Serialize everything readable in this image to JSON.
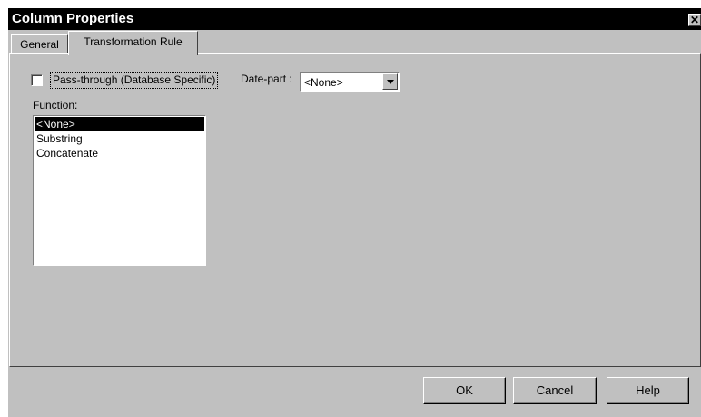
{
  "window": {
    "title": "Column Properties",
    "close_glyph": "✕",
    "close_icon": "close-icon"
  },
  "tabs": [
    {
      "label": "General",
      "active": false
    },
    {
      "label": "Transformation Rule",
      "active": true
    }
  ],
  "passthrough": {
    "label": "Pass-through (Database Specific)",
    "checked": false
  },
  "datepart": {
    "label": "Date-part :",
    "selected": "<None>",
    "dropdown_icon": "chevron-down-icon"
  },
  "function": {
    "label": "Function:",
    "items": [
      "<None>",
      "Substring",
      "Concatenate"
    ],
    "selected_index": 0
  },
  "buttons": {
    "ok": "OK",
    "cancel": "Cancel",
    "help": "Help"
  }
}
